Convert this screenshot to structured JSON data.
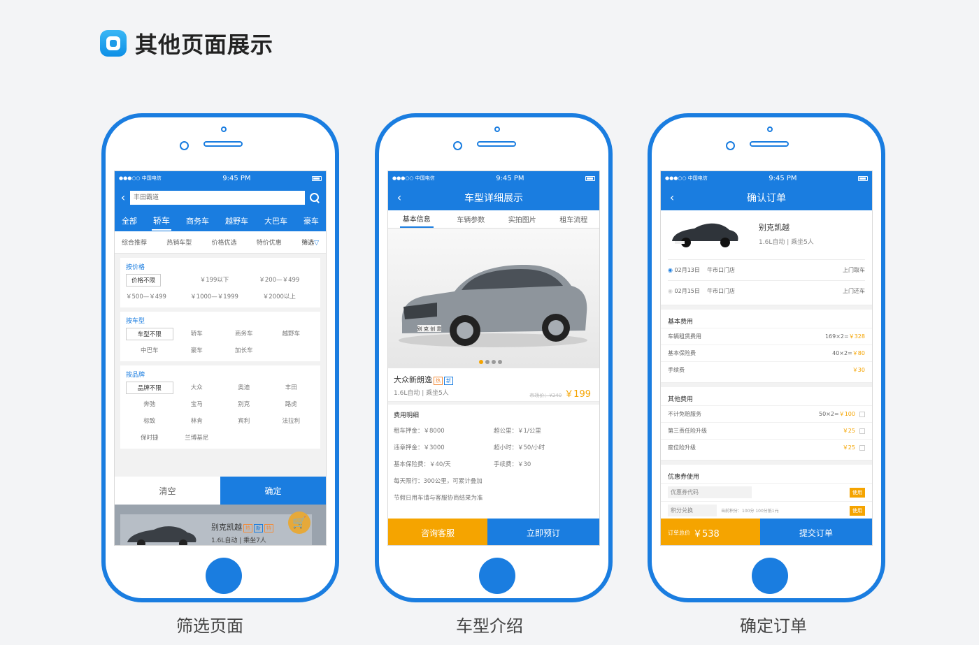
{
  "heading": {
    "title": "其他页面展示"
  },
  "colors": {
    "brand": "#1a7de0",
    "accent": "#f5a400"
  },
  "status": {
    "carrier": "●●●○○ 中国电信",
    "time": "9:45 PM"
  },
  "screens": {
    "filter": {
      "caption": "筛选页面",
      "search_placeholder": "丰田霸道",
      "categories": [
        "全部",
        "轿车",
        "商务车",
        "越野车",
        "大巴车",
        "豪车"
      ],
      "sorts": [
        "综合推荐",
        "热销车型",
        "价格优选",
        "特价优惠",
        "筛选"
      ],
      "price": {
        "title": "按价格",
        "options": [
          "价格不限",
          "￥199以下",
          "￥200—￥499",
          "￥500—￥499",
          "￥1000—￥1999",
          "￥2000以上"
        ]
      },
      "type": {
        "title": "按车型",
        "options": [
          "车型不限",
          "轿车",
          "商务车",
          "越野车",
          "中巴车",
          "豪车",
          "加长车"
        ]
      },
      "brand": {
        "title": "按品牌",
        "options": [
          "品牌不限",
          "大众",
          "奥迪",
          "丰田",
          "奔弛",
          "宝马",
          "别克",
          "路虎",
          "标致",
          "林肯",
          "宾利",
          "法拉利",
          "保时捷",
          "兰博基尼"
        ]
      },
      "clear_label": "清空",
      "confirm_label": "确定",
      "peek": {
        "name": "别克凯越",
        "tags": [
          "热",
          "新",
          "特"
        ],
        "spec": "1.6L自动 | 乘坐7人"
      }
    },
    "detail": {
      "caption": "车型介绍",
      "title": "车型详细展示",
      "tabs": [
        "基本信息",
        "车辆参数",
        "实拍图片",
        "租车流程"
      ],
      "car_plate": "别 克 创 意",
      "car_name": "大众新朗逸",
      "tags": [
        "热",
        "新"
      ],
      "spec": "1.6L自动 | 乘坐5人",
      "old_price": "市场价：¥240",
      "price": "￥199",
      "fee_title": "费用明细",
      "fees": [
        [
          "租车押金：￥8000",
          "超公里：￥1/公里"
        ],
        [
          "违章押金：￥3000",
          "超小时：￥50/小时"
        ],
        [
          "基本保险费：￥40/天",
          "手续费：￥30"
        ]
      ],
      "notes": [
        "每天限行：300公里，可累计叠加",
        "节假日用车请与客服协商结果为准"
      ],
      "consult_label": "咨询客服",
      "book_label": "立即预订"
    },
    "order": {
      "caption": "确定订单",
      "title": "确认订单",
      "car_name": "别克凯越",
      "spec": "1.6L自动 | 乘坐5人",
      "pickup": {
        "date": "02月13日",
        "store": "牛市口门店",
        "action": "上门取车"
      },
      "return": {
        "date": "02月15日",
        "store": "牛市口门店",
        "action": "上门还车"
      },
      "basic_title": "基本费用",
      "basic": [
        {
          "label": "车辆租赁费用",
          "calc": "169×2=",
          "amount": "￥328"
        },
        {
          "label": "基本保险费",
          "calc": "40×2=",
          "amount": "￥80"
        },
        {
          "label": "手续费",
          "calc": "",
          "amount": "￥30"
        }
      ],
      "other_title": "其他费用",
      "other": [
        {
          "label": "不计免赔服务",
          "calc": "50×2=",
          "amount": "￥100"
        },
        {
          "label": "第三责任险升级",
          "calc": "",
          "amount": "￥25"
        },
        {
          "label": "座位险升级",
          "calc": "",
          "amount": "￥25"
        }
      ],
      "coupon_title": "优惠券使用",
      "coupon_placeholder": "优惠券代码",
      "use_label": "使用",
      "points_placeholder": "积分兑换",
      "points_hint": "当前积分：100分  100分抵1元",
      "total_label": "订单总价",
      "total": "￥538",
      "submit_label": "提交订单"
    }
  }
}
